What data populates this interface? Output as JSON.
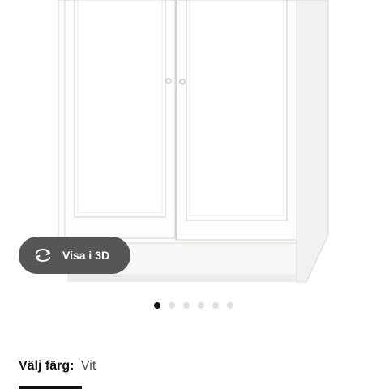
{
  "view_3d": {
    "label": "Visa i 3D",
    "icon": "rotate-3d-icon"
  },
  "carousel": {
    "total": 6,
    "active_index": 0
  },
  "color_selector": {
    "label": "Välj färg:",
    "value": "Vit"
  },
  "colors": {
    "background": "#ffffff",
    "pill": "#484848",
    "dot_active": "#111111",
    "dot_inactive": "#dfdfdf"
  }
}
